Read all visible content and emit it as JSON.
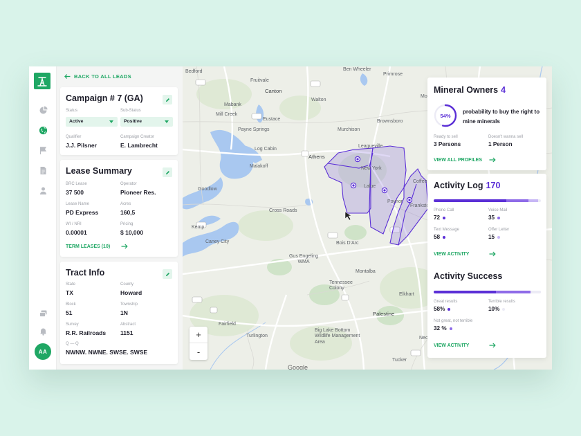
{
  "nav": {
    "back_label": "BACK TO ALL LEADS",
    "avatar_initials": "AA"
  },
  "campaign": {
    "title": "Campaign # 7 (GA)",
    "status_label": "Status",
    "status_value": "Active",
    "substatus_label": "Sub-Status",
    "substatus_value": "Positive",
    "qualifier_label": "Qualifier",
    "qualifier_value": "J.J. Pilsner",
    "creator_label": "Campaign Creator",
    "creator_value": "E. Lambrecht"
  },
  "lease": {
    "title": "Lease Summary",
    "brc_label": "BRC Lease",
    "brc_value": "37 500",
    "operator_label": "Operator",
    "operator_value": "Pioneer Res.",
    "lease_name_label": "Lease Name",
    "lease_name_value": "PD Express",
    "acres_label": "Acres",
    "acres_value": "160,5",
    "wi_label": "WI / NRI",
    "wi_value": "0.00001",
    "pricing_label": "Pricing",
    "pricing_value": "$ 10,000",
    "terms_link": "TERM LEASES (10)"
  },
  "tract": {
    "title": "Tract Info",
    "state_label": "State",
    "state_value": "TX",
    "county_label": "County",
    "county_value": "Howard",
    "block_label": "Block",
    "block_value": "51",
    "township_label": "Township",
    "township_value": "1N",
    "survey_label": "Survey",
    "survey_value": "R.R. Railroads",
    "abstract_label": "Abstract",
    "abstract_value": "1151",
    "qq_label": "Q — Q",
    "qq_value": "NWNW. NWNE. SWSE. SWSE"
  },
  "map": {
    "towns": [
      "Bedford",
      "Ben Wheeler",
      "Primrose",
      "Fruitvale",
      "Canton",
      "Walton",
      "Mabank",
      "Moore",
      "Mill Creek",
      "Eustace",
      "Brownsboro",
      "Payne Springs",
      "Murchison",
      "Log Cabin",
      "Athens",
      "Leagueville",
      "Malakoff",
      "New York",
      "Coffee",
      "Goodlow",
      "Lalue",
      "Poynor",
      "Frankston",
      "Cross Roads",
      "Kemp",
      "Caney City",
      "Bois D'Arc",
      "Gus Engeling WMA",
      "Tennessee Colony",
      "Montalba",
      "Elkhart",
      "Fairfield",
      "Palestine",
      "Turlington",
      "Big Lake Bottom Wildlife Management Area",
      "Neches",
      "Tucker"
    ],
    "zoom_in": "+",
    "zoom_out": "-",
    "attribution": "Google",
    "region_color": "#7b5cd6"
  },
  "mineral_owners": {
    "title": "Mineral Owners",
    "count": "4",
    "probability": "54%",
    "probability_fraction": 0.54,
    "probability_text": "probability to buy the right to mine minerals",
    "ready_label": "Ready to sell",
    "ready_value": "3 Persons",
    "not_ready_label": "Doesn't wanna sell",
    "not_ready_value": "1 Person",
    "link": "VIEW ALL PROFILES"
  },
  "activity_log": {
    "title": "Activity Log",
    "count": "170",
    "phone_label": "Phone Call",
    "phone_value": "72",
    "voicemail_label": "Voice Mail",
    "voicemail_value": "35",
    "text_label": "Text Message",
    "text_value": "58",
    "offer_label": "Offer Letter",
    "offer_value": "15",
    "link": "VIEW ACTIVITY"
  },
  "activity_success": {
    "title": "Activity Success",
    "great_label": "Great results",
    "great_value": "58%",
    "terrible_label": "Terrible results",
    "terrible_value": "10%",
    "neutral_label": "Not great, not terrible",
    "neutral_value": "32 %",
    "link": "VIEW ACTIVITY"
  },
  "colors": {
    "brand_green": "#1fa764",
    "accent_purple": "#5b2fd6",
    "mid_purple": "#8e6be8",
    "light_purple": "#c7b6f5"
  }
}
